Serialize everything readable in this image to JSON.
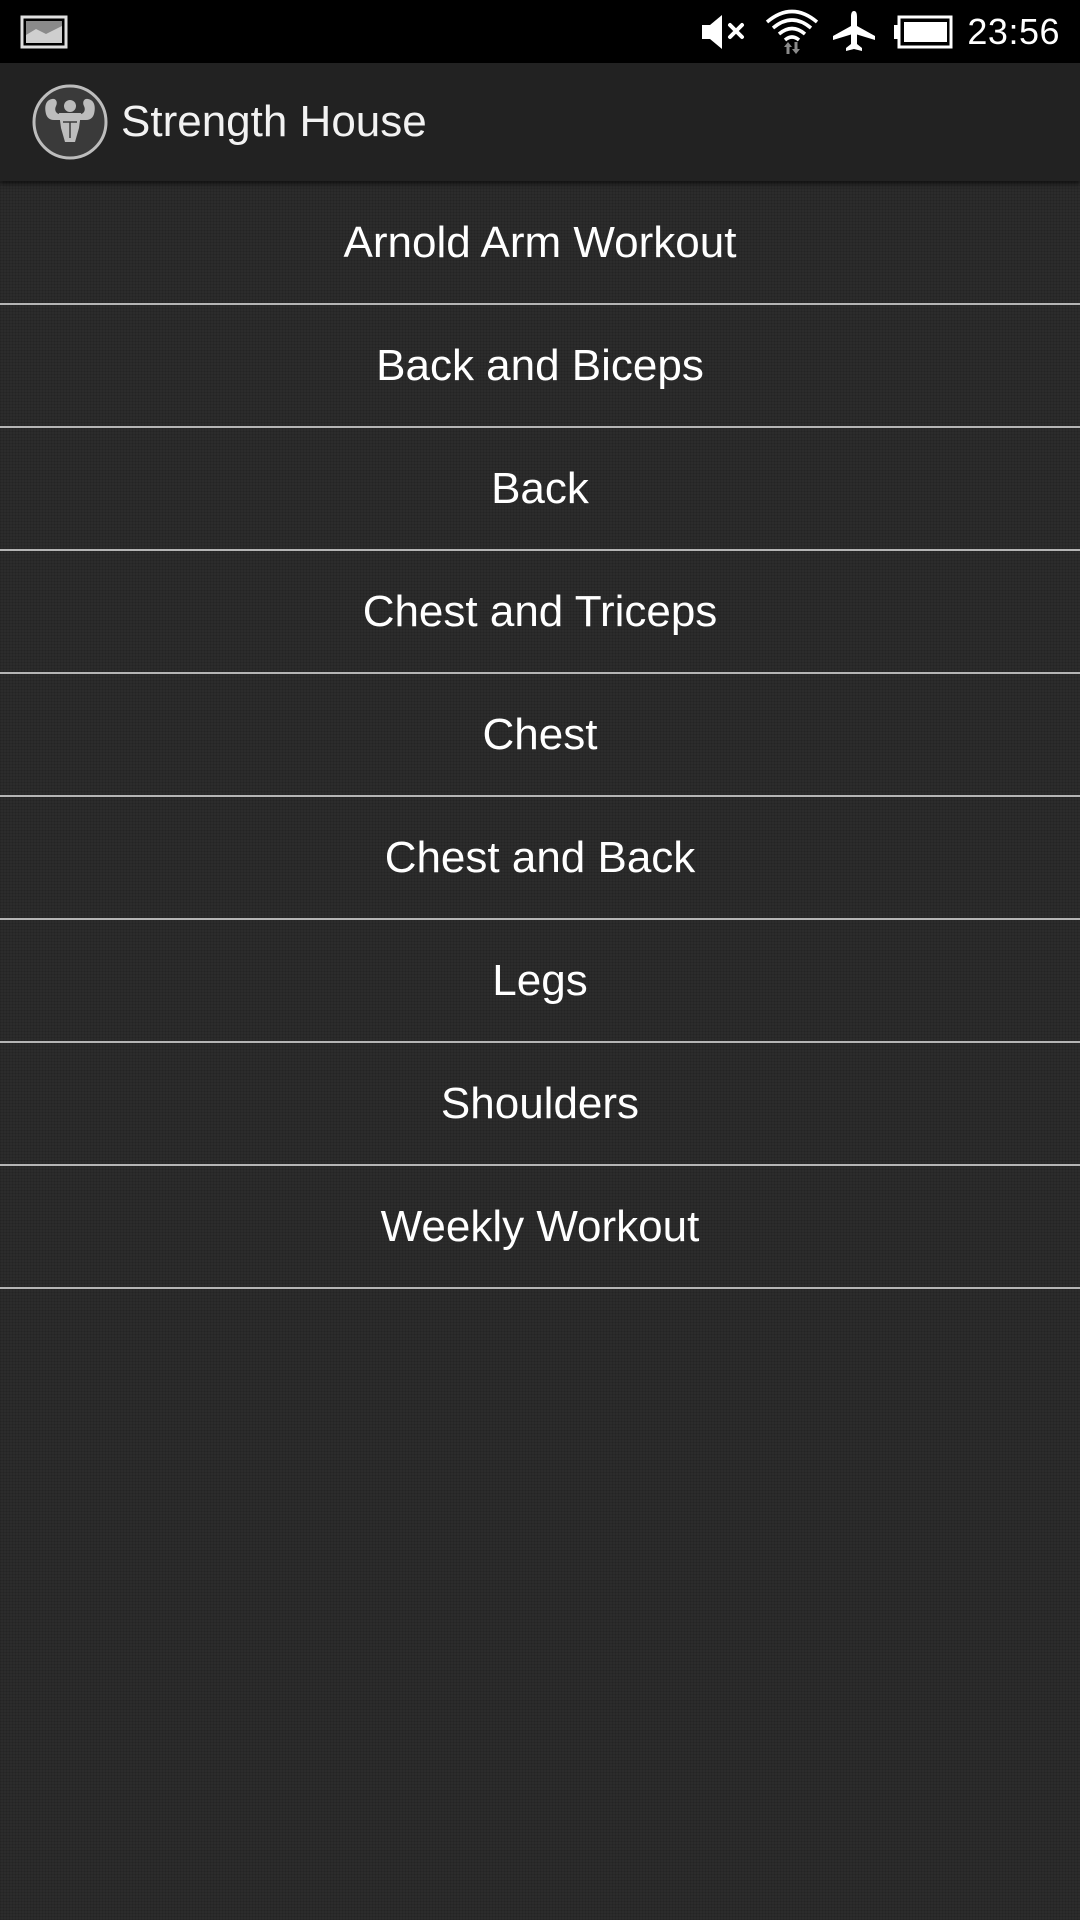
{
  "status_bar": {
    "time": "23:56",
    "icons": [
      "screenshot-notification-icon",
      "volume-muted-icon",
      "wifi-icon",
      "airplane-mode-icon",
      "battery-icon"
    ]
  },
  "action_bar": {
    "title": "Strength House",
    "icon": "bodybuilder-logo-icon"
  },
  "workouts": [
    {
      "label": "Arnold Arm Workout"
    },
    {
      "label": "Back and Biceps"
    },
    {
      "label": "Back"
    },
    {
      "label": "Chest and Triceps"
    },
    {
      "label": "Chest"
    },
    {
      "label": "Chest and Back"
    },
    {
      "label": "Legs"
    },
    {
      "label": "Shoulders"
    },
    {
      "label": "Weekly Workout"
    }
  ],
  "colors": {
    "background": "#2c2c2c",
    "action_bar": "#222222",
    "status_bar": "#000000",
    "divider": "#b5b5b5",
    "text": "#ffffff"
  }
}
